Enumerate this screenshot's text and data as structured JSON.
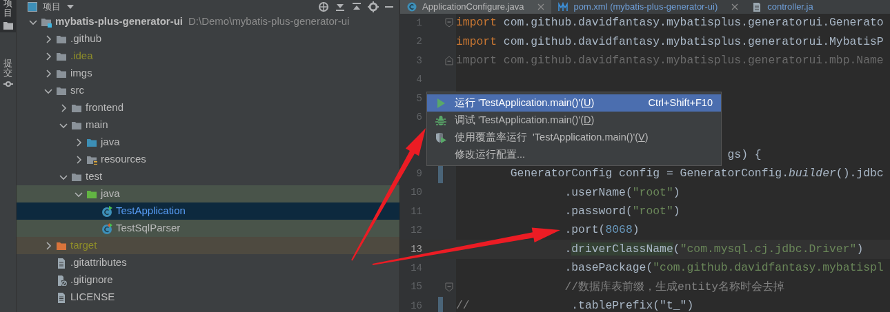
{
  "tool_stripe": {
    "tabs": [
      {
        "label": "项目",
        "selected": true
      },
      {
        "label": "提交",
        "selected": false
      }
    ]
  },
  "project_panel": {
    "title": "项目",
    "tree": [
      {
        "name": "mybatis-plus-generator-ui",
        "path": "D:\\Demo\\mybatis-plus-generator-ui",
        "kind": "module",
        "expanded": true,
        "selected": false,
        "children": [
          {
            "name": ".github",
            "kind": "folder",
            "expanded": false,
            "selected": false
          },
          {
            "name": ".idea",
            "kind": "folder",
            "expanded": false,
            "selected": false,
            "ignored": true
          },
          {
            "name": "imgs",
            "kind": "folder",
            "expanded": false,
            "selected": false
          },
          {
            "name": "src",
            "kind": "folder",
            "expanded": true,
            "selected": false,
            "children": [
              {
                "name": "frontend",
                "kind": "folder",
                "expanded": false,
                "selected": false
              },
              {
                "name": "main",
                "kind": "folder",
                "expanded": true,
                "selected": false,
                "children": [
                  {
                    "name": "java",
                    "kind": "source",
                    "expanded": false,
                    "selected": false
                  },
                  {
                    "name": "resources",
                    "kind": "resources",
                    "expanded": false,
                    "selected": false
                  }
                ]
              },
              {
                "name": "test",
                "kind": "folder",
                "expanded": true,
                "selected": false,
                "children": [
                  {
                    "name": "java",
                    "kind": "test-source",
                    "expanded": true,
                    "selected": false,
                    "test_scope": true,
                    "children": [
                      {
                        "name": "TestApplication",
                        "kind": "class-run",
                        "selected": true,
                        "modified": true
                      },
                      {
                        "name": "TestSqlParser",
                        "kind": "class-mixed",
                        "selected": false,
                        "test_scope": true
                      }
                    ]
                  }
                ]
              }
            ]
          },
          {
            "name": "target",
            "kind": "excluded",
            "expanded": false,
            "selected": false,
            "ignored": true
          },
          {
            "name": ".gitattributes",
            "kind": "file",
            "selected": false
          },
          {
            "name": ".gitignore",
            "kind": "ignore-file",
            "selected": false
          },
          {
            "name": "LICENSE",
            "kind": "file",
            "selected": false
          }
        ]
      }
    ]
  },
  "editor": {
    "tabs": [
      {
        "label": "ApplicationConfigure.java",
        "kind": "class",
        "selected": true,
        "modified": false,
        "closable": true
      },
      {
        "label": "pom.xml (mybatis-plus-generator-ui)",
        "kind": "maven",
        "selected": false,
        "modified": true,
        "closable": true
      },
      {
        "label": "controller.ja",
        "kind": "file",
        "selected": false,
        "modified": true,
        "closable": false
      }
    ],
    "lines": [
      {
        "number": "1",
        "fold_open": true,
        "fold_close": false,
        "current": false,
        "changed": false,
        "segments": [
          {
            "text": "import ",
            "kind": "keyword"
          },
          {
            "text": "com.github.davidfantasy.mybatisplus.generatorui.Generato",
            "kind": "plain"
          }
        ]
      },
      {
        "number": "2",
        "fold_open": false,
        "fold_close": false,
        "current": false,
        "changed": false,
        "segments": [
          {
            "text": "import ",
            "kind": "keyword"
          },
          {
            "text": "com.github.davidfantasy.mybatisplus.generatorui.MybatisP",
            "kind": "plain"
          }
        ]
      },
      {
        "number": "3",
        "fold_open": false,
        "fold_close": true,
        "current": false,
        "changed": false,
        "segments": [
          {
            "text": "import com.github.davidfantasy.mybatisplus.generatorui.mbp.Name",
            "kind": "unused"
          }
        ]
      },
      {
        "number": "4",
        "fold_open": false,
        "fold_close": false,
        "current": false,
        "changed": false
      },
      {
        "number": "5",
        "fold_open": false,
        "fold_close": false,
        "current": false,
        "changed": false
      },
      {
        "number": "6",
        "fold_open": false,
        "fold_close": false,
        "current": false,
        "changed": false
      },
      {
        "fold_open": false,
        "fold_close": false,
        "changed": false
      },
      {
        "fold_open": false,
        "fold_close": false,
        "changed": false,
        "segments": [
          {
            "text": "                                        gs) {",
            "kind": "plain"
          }
        ]
      },
      {
        "number": "9",
        "fold_open": false,
        "fold_close": false,
        "current": false,
        "changed": true,
        "segments": [
          {
            "text": "        GeneratorConfig config = GeneratorConfig.",
            "kind": "plain"
          },
          {
            "text": "builder",
            "kind": "italic"
          },
          {
            "text": "().jdbc",
            "kind": "plain"
          }
        ]
      },
      {
        "number": "10",
        "fold_open": false,
        "fold_close": false,
        "current": false,
        "changed": false,
        "segments": [
          {
            "text": "                .userName(",
            "kind": "plain"
          },
          {
            "text": "\"root\"",
            "kind": "string"
          },
          {
            "text": ")",
            "kind": "plain"
          }
        ]
      },
      {
        "number": "11",
        "fold_open": false,
        "fold_close": false,
        "current": false,
        "changed": false,
        "segments": [
          {
            "text": "                .password(",
            "kind": "plain"
          },
          {
            "text": "\"root\"",
            "kind": "string"
          },
          {
            "text": ")",
            "kind": "plain"
          }
        ]
      },
      {
        "number": "12",
        "fold_open": false,
        "fold_close": false,
        "current": false,
        "changed": false,
        "segments": [
          {
            "text": "                .port(",
            "kind": "plain"
          },
          {
            "text": "8068",
            "kind": "number"
          },
          {
            "text": ")",
            "kind": "plain"
          }
        ]
      },
      {
        "number": "13",
        "fold_open": false,
        "fold_close": false,
        "current": true,
        "changed": false,
        "segments": [
          {
            "text": "                .",
            "kind": "plain"
          },
          {
            "text": "driverClassName",
            "kind": "match"
          },
          {
            "text": "(",
            "kind": "plain"
          },
          {
            "text": "\"com.mysql.cj.jdbc.Driver\"",
            "kind": "string"
          },
          {
            "text": ")",
            "kind": "plain"
          }
        ]
      },
      {
        "number": "14",
        "fold_open": false,
        "fold_close": false,
        "current": false,
        "changed": false,
        "segments": [
          {
            "text": "                .basePackage(",
            "kind": "plain"
          },
          {
            "text": "\"com.github.davidfantasy.mybatispl",
            "kind": "string"
          }
        ]
      },
      {
        "number": "15",
        "fold_open": true,
        "fold_close": false,
        "current": false,
        "changed": false,
        "segments": [
          {
            "text": "                //数据库表前缀，生成entity名称时会去掉",
            "kind": "comment"
          }
        ]
      },
      {
        "number": "16",
        "fold_open": false,
        "fold_close": false,
        "current": false,
        "changed": true,
        "segments": [
          {
            "text": "//",
            "kind": "comment"
          },
          {
            "text": "               .tablePrefix(\"t_\")",
            "kind": "plain"
          }
        ]
      }
    ]
  },
  "context_menu": {
    "items": [
      {
        "kind": "run",
        "text": "运行 'TestApplication.main()'(",
        "mnemonic": "U",
        "text_end": ")",
        "shortcut": "Ctrl+Shift+F10",
        "selected": true
      },
      {
        "kind": "debug",
        "text": "调试 'TestApplication.main()'(",
        "mnemonic": "D",
        "text_end": ")",
        "selected": false
      },
      {
        "kind": "coverage",
        "text": "使用覆盖率运行  'TestApplication.main()'(",
        "mnemonic": "V",
        "text_end": ")",
        "selected": false
      },
      {
        "kind": "plain",
        "text": "修改运行配置...",
        "selected": false
      }
    ]
  }
}
